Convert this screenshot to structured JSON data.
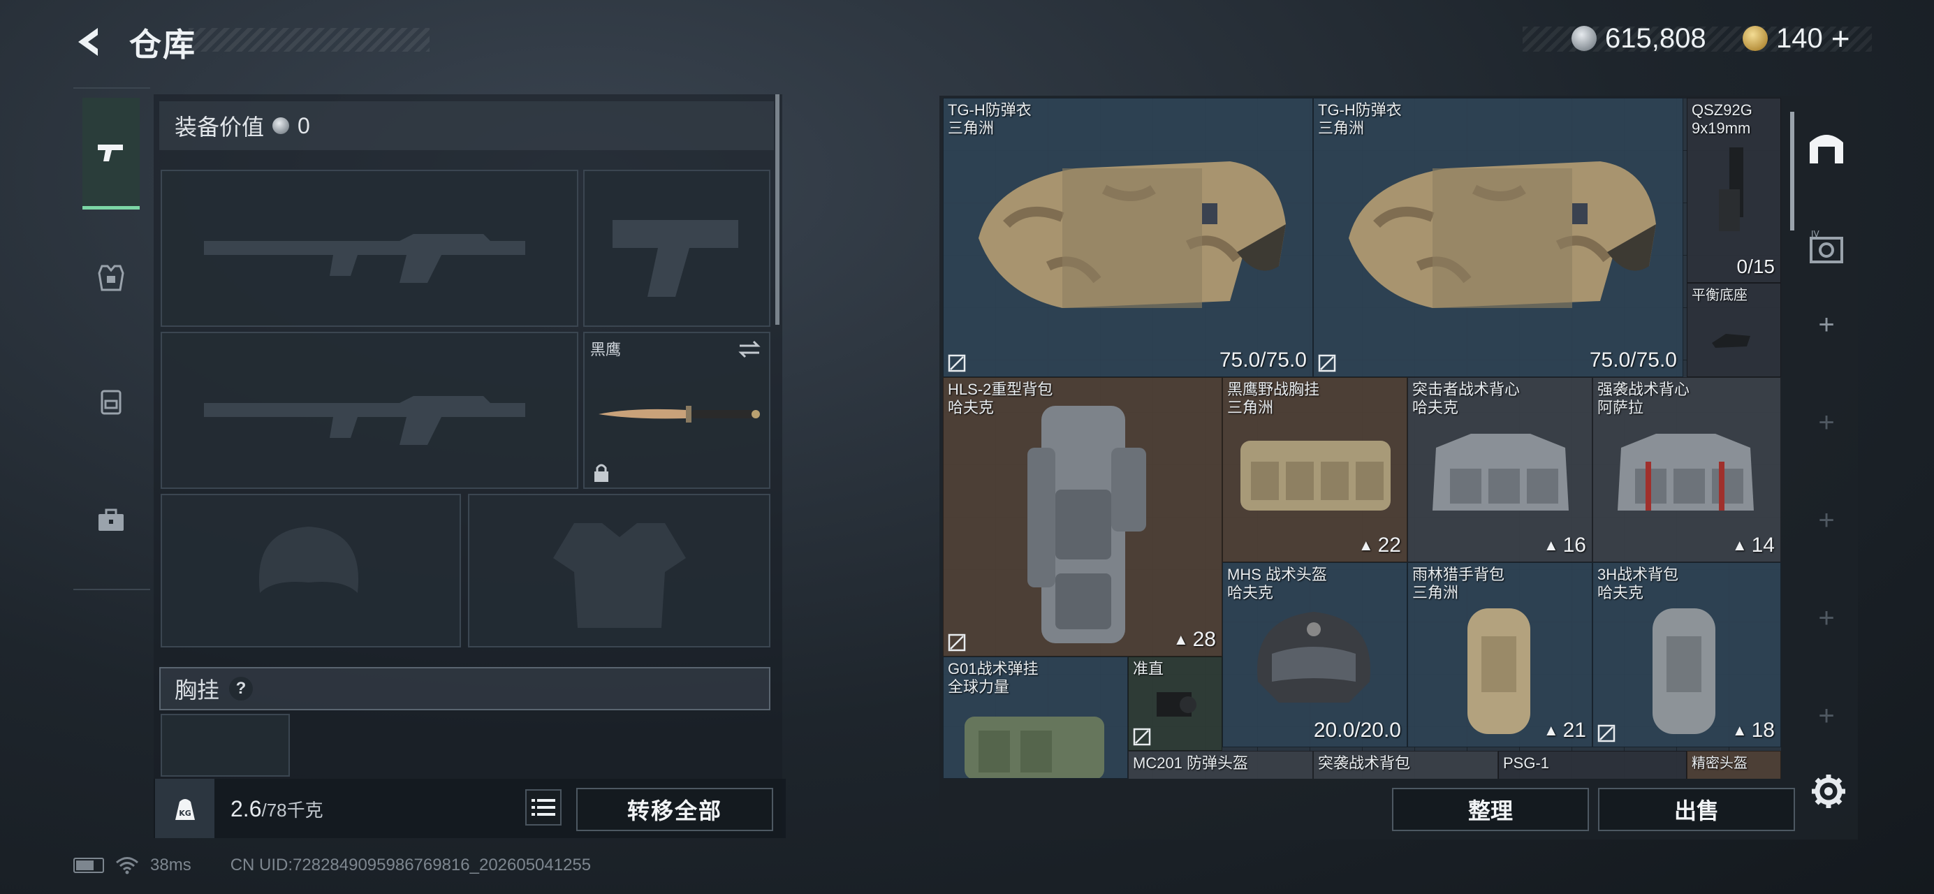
{
  "header": {
    "title": "仓库",
    "silver_amount": "615,808",
    "gold_amount": "140",
    "gold_plus": "+"
  },
  "loadout": {
    "value_label": "装备价值",
    "value_amount": "0",
    "tabs": [
      "pistol-icon",
      "armor-icon",
      "backpack-icon",
      "toolbox-icon"
    ],
    "melee_name": "黑鹰",
    "chest_label": "胸挂",
    "chest_help": "?",
    "weight_current": "2.6",
    "weight_max": "/78千克",
    "transfer_label": "转移全部"
  },
  "status": {
    "ping": "38ms",
    "uid": "CN UID:7282849095986769816_202605041255"
  },
  "stash": {
    "items": [
      {
        "name": "TG-H防弹衣",
        "sub": "三角洲",
        "stat": "75.0/75.0"
      },
      {
        "name": "TG-H防弹衣",
        "sub": "三角洲",
        "stat": "75.0/75.0"
      },
      {
        "name": "QSZ92G",
        "sub": "9x19mm",
        "stat": "0/15"
      },
      {
        "name": "平衡底座",
        "sub": "",
        "stat": ""
      },
      {
        "name": "HLS-2重型背包",
        "sub": "哈夫克",
        "stat": "28"
      },
      {
        "name": "黑鹰野战胸挂",
        "sub": "三角洲",
        "stat": "22"
      },
      {
        "name": "突击者战术背心",
        "sub": "哈夫克",
        "stat": "16"
      },
      {
        "name": "强袭战术背心",
        "sub": "阿萨拉",
        "stat": "14"
      },
      {
        "name": "MHS 战术头盔",
        "sub": "哈夫克",
        "stat": "20.0/20.0"
      },
      {
        "name": "雨林猎手背包",
        "sub": "三角洲",
        "stat": "21"
      },
      {
        "name": "3H战术背包",
        "sub": "哈夫克",
        "stat": "18"
      },
      {
        "name": "G01战术弹挂",
        "sub": "全球力量",
        "stat": ""
      },
      {
        "name": "准直",
        "sub": "",
        "stat": ""
      },
      {
        "name": "MC201 防弹头盔",
        "sub": "",
        "stat": ""
      },
      {
        "name": "突袭战术背包",
        "sub": "",
        "stat": ""
      },
      {
        "name": "PSG-1",
        "sub": "",
        "stat": ""
      },
      {
        "name": "精密头盔",
        "sub": "",
        "stat": ""
      }
    ],
    "sort_label": "整理",
    "sell_label": "出售"
  },
  "colors": {
    "accent_green": "#7cd6a5",
    "blue_cell": "#2e4254",
    "brown_cell": "#4e4036"
  }
}
